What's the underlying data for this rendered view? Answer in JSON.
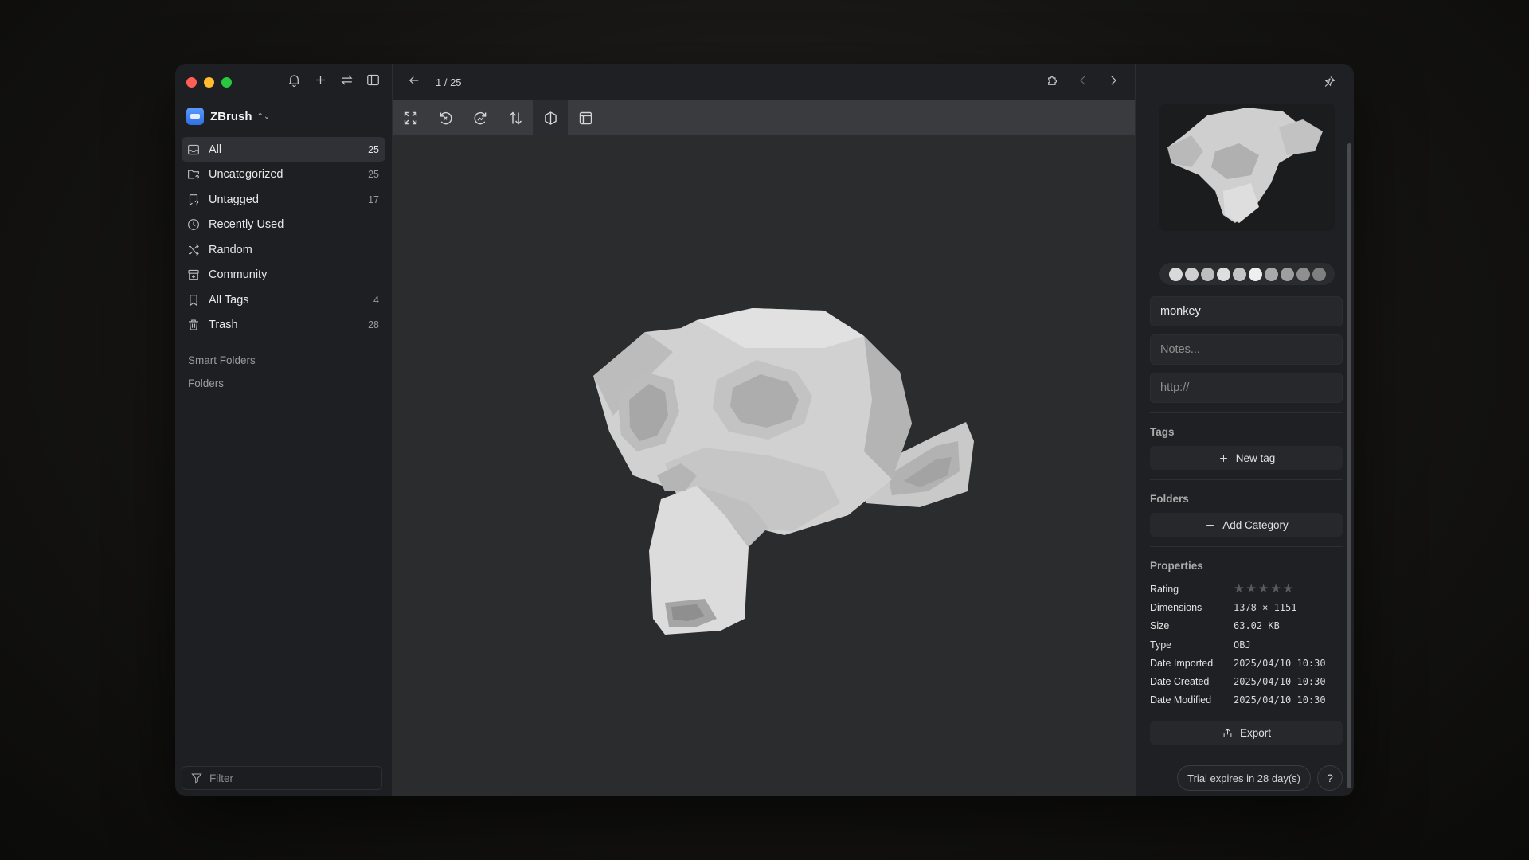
{
  "sidebar": {
    "library_name": "ZBrush",
    "items": [
      {
        "label": "All",
        "count": "25",
        "icon": "inbox-icon"
      },
      {
        "label": "Uncategorized",
        "count": "25",
        "icon": "folder-question-icon"
      },
      {
        "label": "Untagged",
        "count": "17",
        "icon": "tag-question-icon"
      },
      {
        "label": "Recently Used",
        "count": "",
        "icon": "clock-icon"
      },
      {
        "label": "Random",
        "count": "",
        "icon": "shuffle-icon"
      },
      {
        "label": "Community",
        "count": "",
        "icon": "archive-icon"
      },
      {
        "label": "All Tags",
        "count": "4",
        "icon": "bookmark-icon"
      },
      {
        "label": "Trash",
        "count": "28",
        "icon": "trash-icon"
      }
    ],
    "smart_folders_label": "Smart Folders",
    "folders_label": "Folders",
    "filter_placeholder": "Filter"
  },
  "viewer": {
    "pager": "1 / 25"
  },
  "inspector": {
    "name_value": "monkey",
    "notes_placeholder": "Notes...",
    "url_placeholder": "http://",
    "tags_title": "Tags",
    "new_tag_label": "New tag",
    "folders_title": "Folders",
    "add_category_label": "Add Category",
    "properties_title": "Properties",
    "properties": {
      "rating_label": "Rating",
      "rating_value": 0,
      "dimensions_label": "Dimensions",
      "dimensions_value": "1378 × 1151",
      "size_label": "Size",
      "size_value": "63.02 KB",
      "type_label": "Type",
      "type_value": "OBJ",
      "date_imported_label": "Date Imported",
      "date_imported_value": "2025/04/10 10:30",
      "date_created_label": "Date Created",
      "date_created_value": "2025/04/10 10:30",
      "date_modified_label": "Date Modified",
      "date_modified_value": "2025/04/10 10:30"
    },
    "export_label": "Export",
    "trial_text": "Trial expires in 28 day(s)",
    "help_label": "?",
    "palette": [
      "#d9d9d9",
      "#cfcfcf",
      "#bdbdbd",
      "#dedede",
      "#c4c4c4",
      "#efefef",
      "#a9a9a9",
      "#9e9e9e",
      "#8f8f8f",
      "#7f7f7f"
    ]
  }
}
